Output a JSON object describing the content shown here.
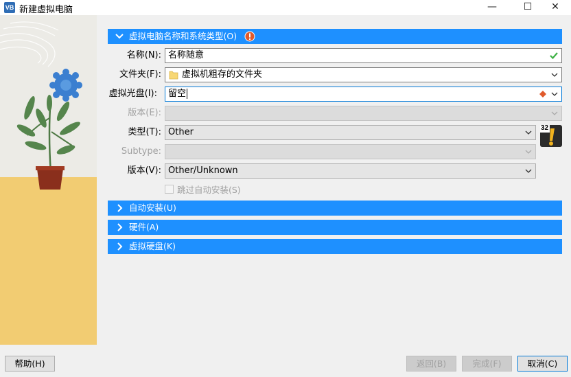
{
  "window": {
    "title": "新建虚拟电脑",
    "app_icon_text": "VB",
    "minimize": "—",
    "maximize": "☐",
    "close": "✕"
  },
  "sections": {
    "name_os": {
      "label": "虚拟电脑名称和系统类型(O)",
      "expanded": true
    },
    "unattended": {
      "label": "自动安装(U)",
      "expanded": false
    },
    "hardware": {
      "label": "硬件(A)",
      "expanded": false
    },
    "hard_disk": {
      "label": "虚拟硬盘(K)",
      "expanded": false
    }
  },
  "form": {
    "name_label": "名称(N):",
    "name_value": "名称随意",
    "folder_label": "文件夹(F):",
    "folder_value": "虚拟机粗存的文件夹",
    "iso_label": "虚拟光盘(I):",
    "iso_value": "留空",
    "edition_label": "版本(E):",
    "edition_value": "",
    "type_label": "类型(T):",
    "type_value": "Other",
    "subtype_label": "Subtype:",
    "subtype_value": "",
    "version_label": "版本(V):",
    "version_value": "Other/Unknown",
    "skip_unattended_label": "跳过自动安装(S)",
    "skip_unattended_checked": false,
    "os_icon_badge": "32"
  },
  "buttons": {
    "help": "帮助(H)",
    "back": "返回(B)",
    "finish": "完成(F)",
    "cancel": "取消(C)"
  },
  "colors": {
    "section_header": "#1e90ff",
    "valid_check": "#3cb043",
    "warning": "#e05a2b"
  }
}
